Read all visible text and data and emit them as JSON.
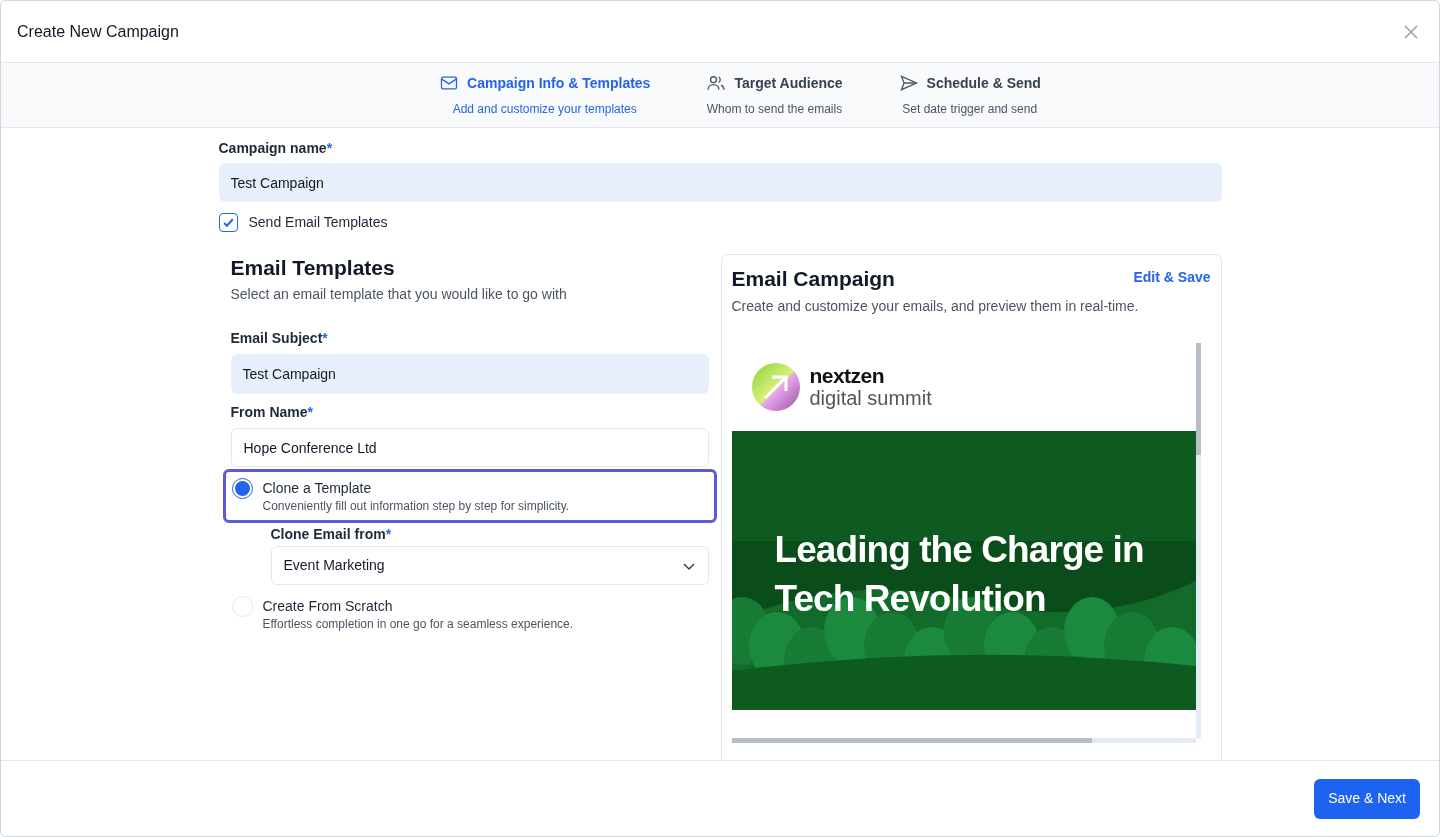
{
  "window": {
    "title": "Create New Campaign"
  },
  "steps": [
    {
      "kind": "mail",
      "title": "Campaign Info & Templates",
      "subtitle": "Add and customize your templates",
      "selected": true
    },
    {
      "kind": "people",
      "title": "Target Audience",
      "subtitle": "Whom to send the emails",
      "selected": false
    },
    {
      "kind": "send",
      "title": "Schedule & Send",
      "subtitle": "Set date trigger and send",
      "selected": false
    }
  ],
  "campaign_name": {
    "label": "Campaign name",
    "required_mark": "*",
    "value": "Test Campaign"
  },
  "send_templates": {
    "label": "Send Email Templates",
    "checked": true
  },
  "templates": {
    "title": "Email Templates",
    "subtitle": "Select an email template that you would like to go with",
    "email_subject": {
      "label": "Email Subject",
      "required_mark": "*",
      "value": "Test Campaign"
    },
    "from_name": {
      "label": "From Name",
      "required_mark": "*",
      "value": "Hope Conference Ltd"
    },
    "options": [
      {
        "title": "Clone a Template",
        "description": "Conveniently fill out information step by step for simplicity.",
        "selected": true
      },
      {
        "title": "Create From Scratch",
        "description": "Effortless completion in one go for a seamless experience.",
        "selected": false
      }
    ],
    "clone_from": {
      "label": "Clone Email from",
      "required_mark": "*",
      "value": "Event Marketing"
    }
  },
  "preview": {
    "title": "Email Campaign",
    "link": "Edit & Save",
    "subtitle": "Create and customize your emails, and preview them in real-time.",
    "brand_name": "nextzen",
    "brand_tagline": "digital summit",
    "headline": "Leading the Charge in Tech Revolution"
  },
  "footer": {
    "button": "Save & Next"
  }
}
